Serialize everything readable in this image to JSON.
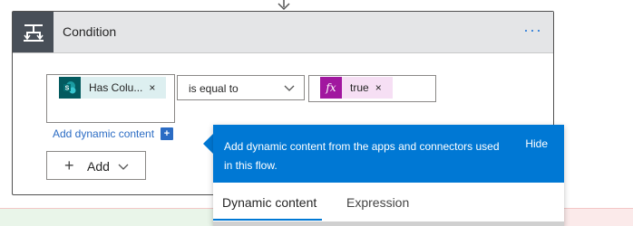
{
  "condition": {
    "title": "Condition",
    "more_label": "···",
    "left_token": {
      "label": "Has Colu...",
      "remove": "×"
    },
    "operator": "is equal to",
    "right_token": {
      "icon_text": "fx",
      "label": "true",
      "remove": "×"
    },
    "add_dynamic_label": "Add dynamic content",
    "add_dynamic_plus": "+",
    "add_button": {
      "plus": "+",
      "label": "Add"
    }
  },
  "popup": {
    "message": "Add dynamic content from the apps and connectors used in this flow.",
    "hide_label": "Hide",
    "tabs": [
      {
        "label": "Dynamic content",
        "selected": true
      },
      {
        "label": "Expression",
        "selected": false
      }
    ]
  },
  "colors": {
    "accent": "#0078d4",
    "header_bg": "#e4e5e7",
    "header_icon_bg": "#484f58",
    "sharepoint": "#035a5f",
    "expression": "#a1179f"
  },
  "icons": {
    "header": "condition-split-icon",
    "left_token": "sharepoint-icon",
    "right_token": "expression-fx-icon"
  }
}
